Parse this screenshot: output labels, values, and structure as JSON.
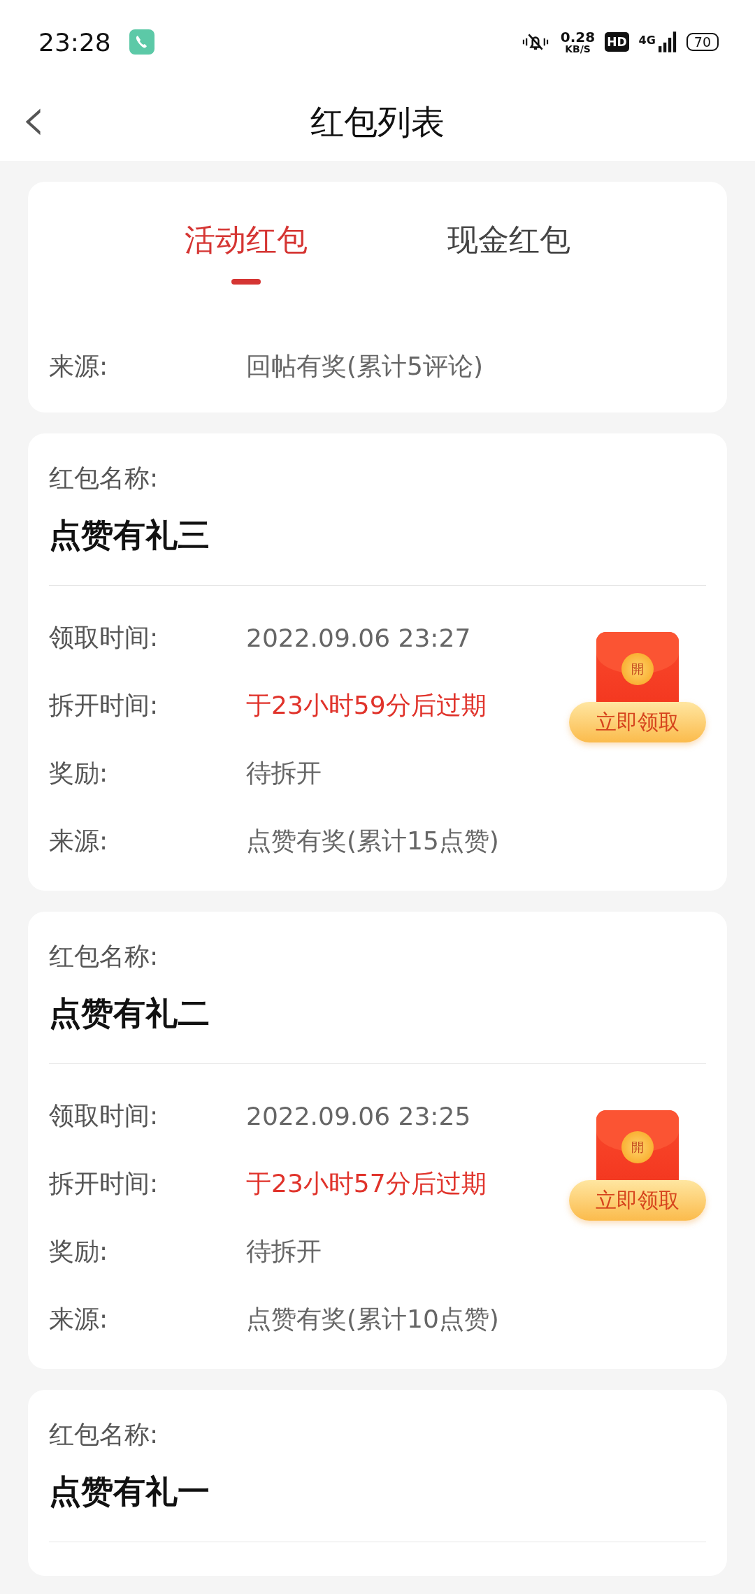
{
  "status_bar": {
    "time": "23:28",
    "speed": "0.28",
    "speed_unit": "KB/S",
    "hd": "HD",
    "network": "4G",
    "battery": "70"
  },
  "header": {
    "back": "‹",
    "title": "红包列表"
  },
  "tabs": [
    {
      "label": "活动红包",
      "selected": true
    },
    {
      "label": "现金红包",
      "selected": false
    }
  ],
  "cards": [
    {
      "kind": "partial",
      "rows": [
        {
          "label": "来源:",
          "value": "回帖有奖(累计5评论)",
          "highlight": false
        }
      ]
    },
    {
      "kind": "full",
      "name_label": "红包名称:",
      "name": "点赞有礼三",
      "envelope_mark": "開",
      "button": "立即领取",
      "rows": [
        {
          "label": "领取时间:",
          "value": "2022.09.06 23:27",
          "highlight": false
        },
        {
          "label": "拆开时间:",
          "value": "于23小时59分后过期",
          "highlight": true
        },
        {
          "label": "奖励:",
          "value": "待拆开",
          "highlight": false
        },
        {
          "label": "来源:",
          "value": "点赞有奖(累计15点赞)",
          "highlight": false
        }
      ]
    },
    {
      "kind": "full",
      "name_label": "红包名称:",
      "name": "点赞有礼二",
      "envelope_mark": "開",
      "button": "立即领取",
      "rows": [
        {
          "label": "领取时间:",
          "value": "2022.09.06 23:25",
          "highlight": false
        },
        {
          "label": "拆开时间:",
          "value": "于23小时57分后过期",
          "highlight": true
        },
        {
          "label": "奖励:",
          "value": "待拆开",
          "highlight": false
        },
        {
          "label": "来源:",
          "value": "点赞有奖(累计10点赞)",
          "highlight": false
        }
      ]
    },
    {
      "kind": "cut",
      "name_label": "红包名称:",
      "name": "点赞有礼一"
    }
  ]
}
